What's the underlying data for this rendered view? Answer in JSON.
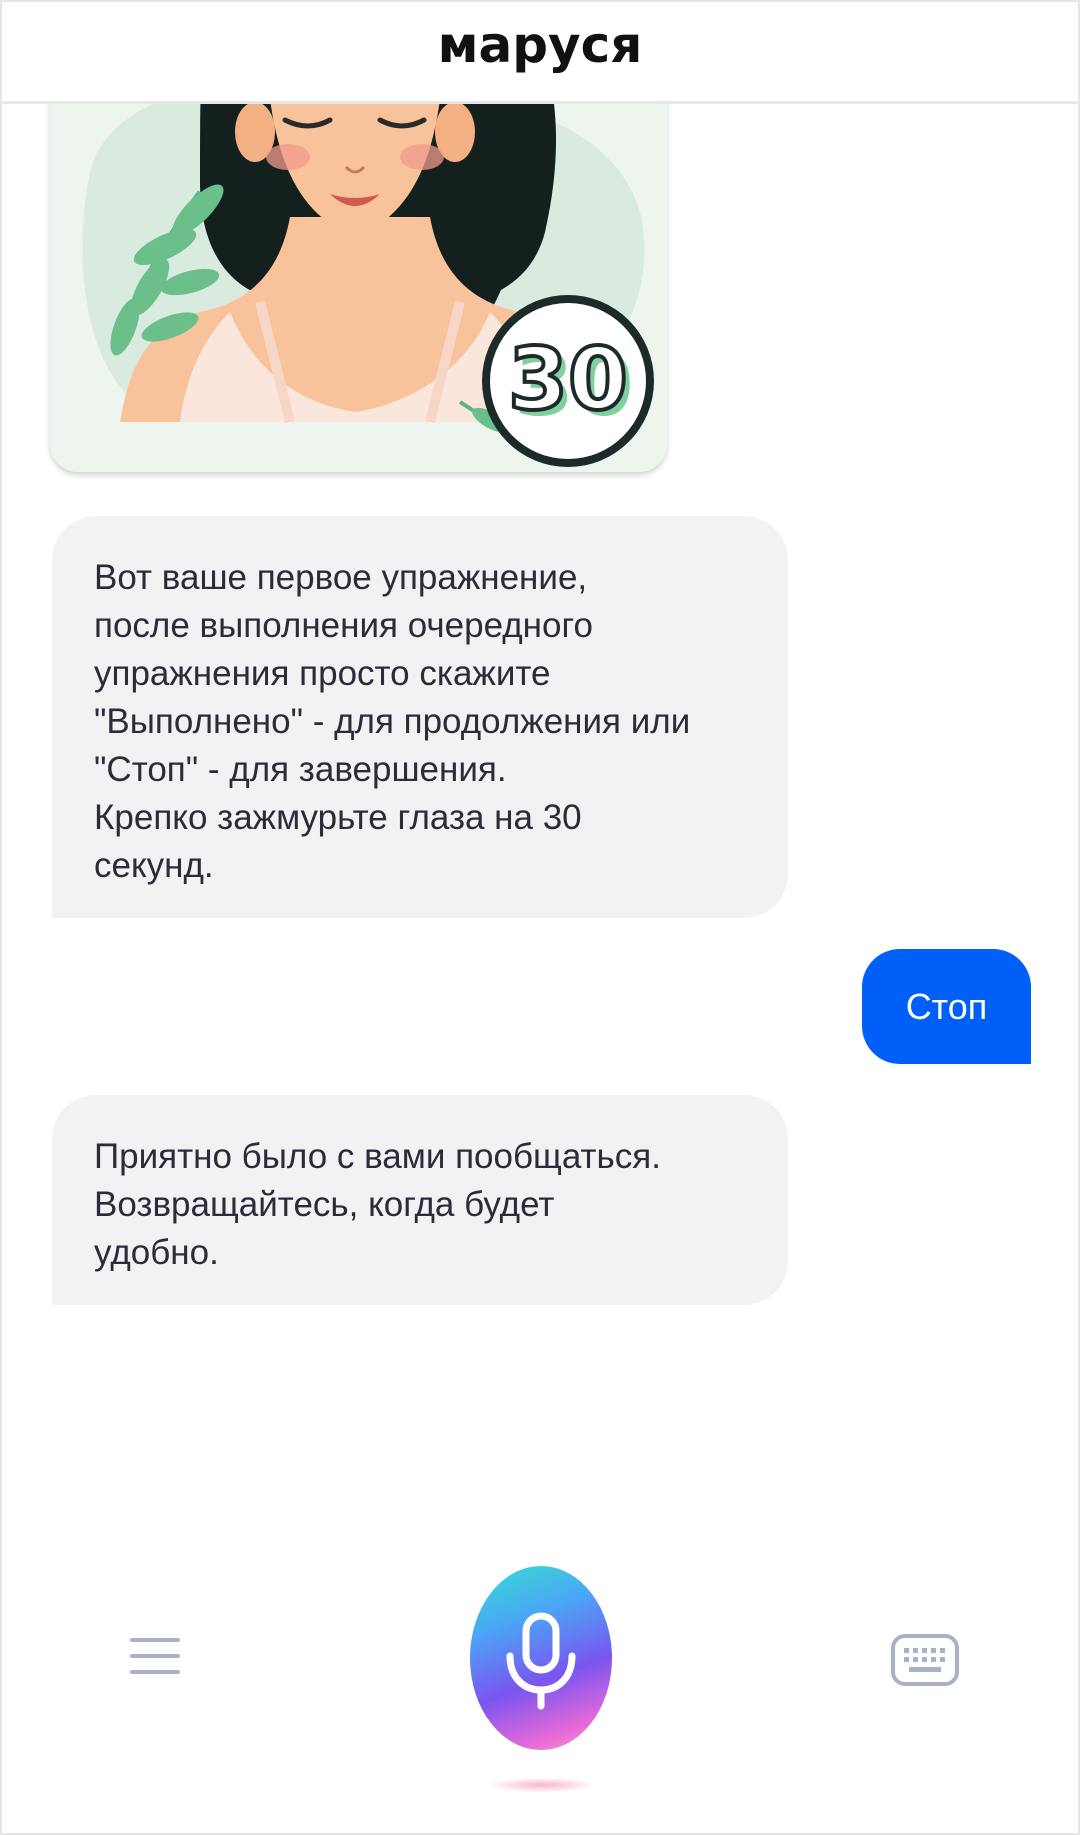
{
  "header": {
    "title": "маруся"
  },
  "chat": {
    "image_badge": "30",
    "messages": [
      {
        "from": "assistant",
        "text": "Вот ваше первое упражнение,\nпосле выполнения очередного\nупражнения просто скажите\n\"Выполнено\" - для продолжения или\n\"Стоп\" - для завершения.\nКрепко зажмурьте глаза на 30\nсекунд."
      },
      {
        "from": "user",
        "text": "Стоп"
      },
      {
        "from": "assistant",
        "text": "Приятно было с вами пообщаться.\nВозвращайтесь, когда будет\nудобно."
      }
    ]
  },
  "bottom_bar": {
    "left_icon": "menu-icon",
    "center_icon": "microphone-icon",
    "right_icon": "keyboard-icon"
  },
  "colors": {
    "user_bubble": "#005ff9",
    "assistant_bubble": "#f2f2f2",
    "icon_gray": "#a9b1c7"
  }
}
